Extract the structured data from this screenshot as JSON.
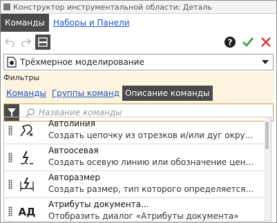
{
  "window": {
    "title": "Конструктор инструментальной области: Деталь"
  },
  "nav_tabs": [
    {
      "label": "Команды",
      "active": true
    },
    {
      "label": "Наборы и Панели",
      "active": false
    }
  ],
  "toolbar": {
    "undo_icon": "undo-icon",
    "redo_icon": "redo-icon",
    "panel_icon": "panel-layout-icon",
    "help_icon": "help-icon",
    "apply_icon": "check-icon",
    "cancel_icon": "close-icon",
    "colors": {
      "apply": "#2e9e3e",
      "cancel": "#d9342b"
    }
  },
  "mode_select": {
    "value": "Трёхмерное моделирование"
  },
  "filters": {
    "label": "Фильтры",
    "tabs": [
      {
        "label": "Команды",
        "active": false
      },
      {
        "label": "Группы команд",
        "active": false
      },
      {
        "label": "Описание команды",
        "active": true
      }
    ]
  },
  "search": {
    "placeholder": "Название команды"
  },
  "commands": [
    {
      "title": "Автолиния",
      "description": "Создать цепочку из отрезков и/или дуг окружностей",
      "icon": "autoline-icon"
    },
    {
      "title": "Автоосевая",
      "description": "Создать осевую линию или обозначение центра в че...",
      "icon": "autoaxis-icon"
    },
    {
      "title": "Авторазмер",
      "description": "Создать размер, тип которого определяется автомати...",
      "icon": "autodimension-icon"
    },
    {
      "title": "Атрибуты документа...",
      "description": "Отобразить диалог «Атрибуты документа»",
      "icon": "document-attributes-icon"
    }
  ],
  "colors": {
    "active_tab_bg": "#4a4a4a",
    "link": "#1a56c8",
    "filter_bg": "#fdf4e0"
  }
}
